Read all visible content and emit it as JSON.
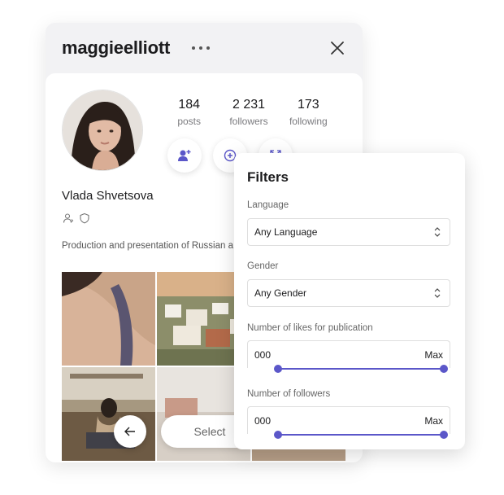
{
  "profile": {
    "username": "maggieelliott",
    "name": "Vlada Shvetsova",
    "bio": "Production and presentation of Russian a",
    "stats": [
      {
        "value": "184",
        "label": "posts"
      },
      {
        "value": "2 231",
        "label": "followers"
      },
      {
        "value": "173",
        "label": "following"
      }
    ],
    "actions": [
      "add-user-icon",
      "add-circle-icon",
      "external-link-icon"
    ],
    "select_label": "Select"
  },
  "filters": {
    "title": "Filters",
    "language": {
      "label": "Language",
      "value": "Any Language"
    },
    "gender": {
      "label": "Gender",
      "value": "Any Gender"
    },
    "likes": {
      "label": "Number of likes for publication",
      "min": "000",
      "max": "Max"
    },
    "followers": {
      "label": "Number of followers",
      "min": "000",
      "max": "Max"
    }
  },
  "colors": {
    "accent": "#5b57c9"
  }
}
